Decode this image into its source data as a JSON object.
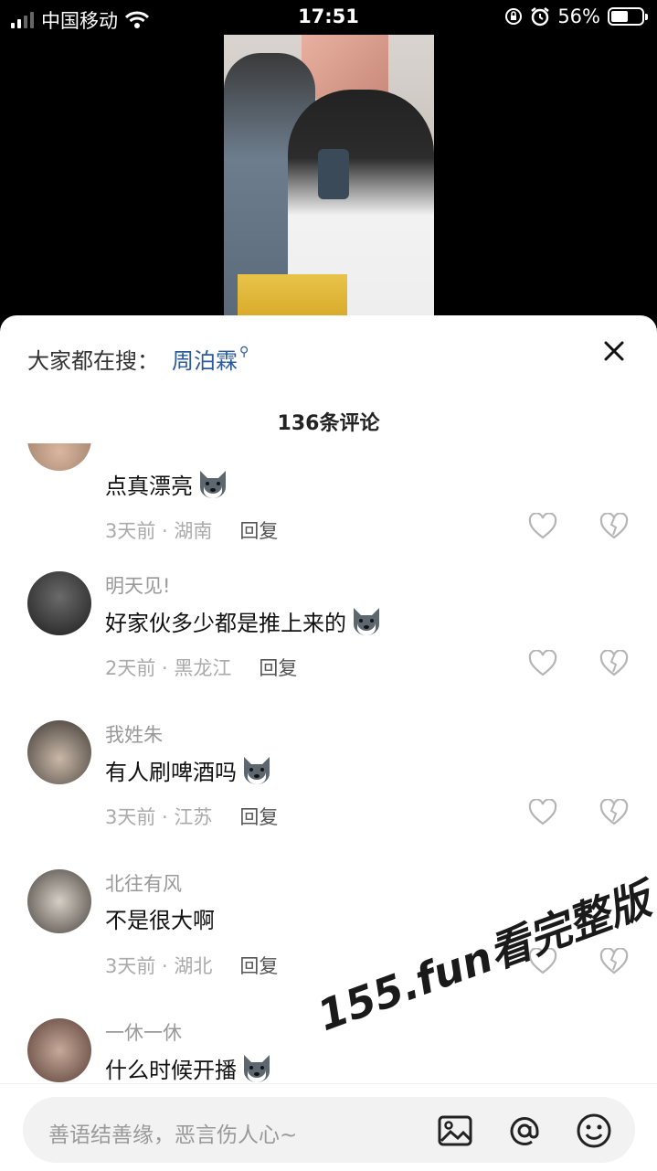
{
  "status_bar": {
    "carrier": "中国移动",
    "time": "17:51",
    "battery": "56%",
    "battery_level": 0.56
  },
  "search_suggest": {
    "prefix": "大家都在搜：",
    "keyword": "周泊霖"
  },
  "comment_count": "136条评论",
  "comments": [
    {
      "username": "",
      "text": "点真漂亮",
      "time": "3天前 · 湖南",
      "reply": "回复"
    },
    {
      "username": "明天见!",
      "text": "好家伙多少都是推上来的",
      "time": "2天前 · 黑龙江",
      "reply": "回复"
    },
    {
      "username": "我姓朱",
      "text": "有人刷啤酒吗",
      "time": "3天前 · 江苏",
      "reply": "回复"
    },
    {
      "username": "北往有风",
      "text": "不是很大啊",
      "time": "3天前 · 湖北",
      "reply": "回复"
    },
    {
      "username": "一休一休",
      "text": "什么时候开播",
      "time": "",
      "reply": ""
    }
  ],
  "watermark": "155.fun看完整版",
  "input": {
    "placeholder": "善语结善缘，恶言伤人心~"
  },
  "icons": [
    "signal-icon",
    "wifi-icon",
    "lock-rotation-icon",
    "alarm-icon",
    "battery-icon",
    "close-icon",
    "heart-icon",
    "broken-heart-icon",
    "husky-emoji-icon",
    "image-icon",
    "at-icon",
    "smiley-icon"
  ]
}
